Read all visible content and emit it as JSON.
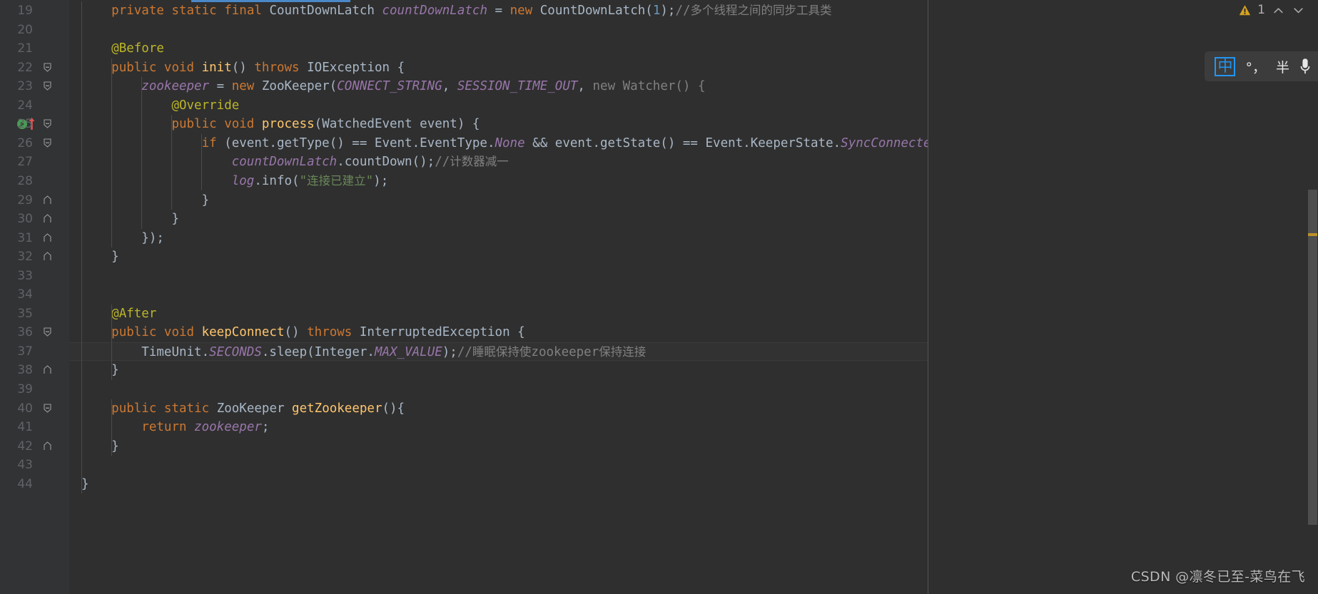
{
  "app": {
    "theme": "darcula",
    "colors": {
      "background": "#2f2f2f",
      "gutter_background": "#313335",
      "current_line_background": "#323232",
      "keyword": "#cc7832",
      "method": "#ffc66d",
      "field": "#9876aa",
      "string": "#6a8759",
      "comment": "#808080",
      "number": "#6897bb",
      "annotation": "#bbb529",
      "default_text": "#a9b7c6",
      "line_number": "#606366",
      "tab_accent": "#4a88c7",
      "warning": "#d6a220",
      "run_marker": "#499c54",
      "override_marker": "#e05252",
      "ime_accent": "#2196f3"
    }
  },
  "inspection_widget": {
    "warning_icon": "warning-triangle-icon",
    "warning_count": "1",
    "prev_icon": "chevron-up-icon",
    "next_icon": "chevron-down-icon"
  },
  "ime_bar": {
    "mode_label": "中",
    "punctuation_label": "°，",
    "width_label": "半",
    "mic_icon": "microphone-icon"
  },
  "scrollbar": {
    "orientation": "vertical",
    "warning_mark_color": "#bb9128"
  },
  "watermark": {
    "text": "CSDN @凛冬已至-菜鸟在飞"
  },
  "editor": {
    "first_visible_line": 19,
    "last_visible_line": 44,
    "current_line": 37,
    "lines": [
      {
        "n": "19",
        "indent": 1,
        "fold": null,
        "tokens": [
          {
            "t": "private ",
            "c": "kw"
          },
          {
            "t": "static ",
            "c": "kw"
          },
          {
            "t": "final ",
            "c": "kw"
          },
          {
            "t": "CountDownLatch ",
            "c": "plain"
          },
          {
            "t": "countDownLatch",
            "c": "field"
          },
          {
            "t": " = ",
            "c": "punc"
          },
          {
            "t": "new ",
            "c": "kw"
          },
          {
            "t": "CountDownLatch(",
            "c": "plain"
          },
          {
            "t": "1",
            "c": "num"
          },
          {
            "t": ");",
            "c": "punc"
          },
          {
            "t": "//多个线程之间的同步工具类",
            "c": "cmt"
          }
        ]
      },
      {
        "n": "20",
        "indent": 1,
        "fold": null,
        "tokens": []
      },
      {
        "n": "21",
        "indent": 1,
        "fold": null,
        "tokens": [
          {
            "t": "@Before",
            "c": "anno"
          }
        ]
      },
      {
        "n": "22",
        "indent": 1,
        "fold": "minus",
        "tokens": [
          {
            "t": "public ",
            "c": "kw"
          },
          {
            "t": "void ",
            "c": "kw"
          },
          {
            "t": "init",
            "c": "fn"
          },
          {
            "t": "() ",
            "c": "punc"
          },
          {
            "t": "throws ",
            "c": "kw"
          },
          {
            "t": "IOException {",
            "c": "plain"
          }
        ]
      },
      {
        "n": "23",
        "indent": 2,
        "fold": "minus",
        "tokens": [
          {
            "t": "zookeeper",
            "c": "field"
          },
          {
            "t": " = ",
            "c": "punc"
          },
          {
            "t": "new ",
            "c": "kw"
          },
          {
            "t": "ZooKeeper(",
            "c": "plain"
          },
          {
            "t": "CONNECT_STRING",
            "c": "const"
          },
          {
            "t": ", ",
            "c": "punc"
          },
          {
            "t": "SESSION_TIME_OUT",
            "c": "const"
          },
          {
            "t": ", ",
            "c": "punc"
          },
          {
            "t": "new Watcher() {",
            "c": "cmt"
          }
        ]
      },
      {
        "n": "24",
        "indent": 3,
        "fold": null,
        "tokens": [
          {
            "t": "@Override",
            "c": "anno"
          }
        ]
      },
      {
        "n": "25",
        "indent": 3,
        "fold": "minus",
        "run_marker": true,
        "override_marker": true,
        "tokens": [
          {
            "t": "public ",
            "c": "kw"
          },
          {
            "t": "void ",
            "c": "kw"
          },
          {
            "t": "process",
            "c": "fn"
          },
          {
            "t": "(WatchedEvent event) {",
            "c": "plain"
          }
        ]
      },
      {
        "n": "26",
        "indent": 4,
        "fold": "minus",
        "tokens": [
          {
            "t": "if ",
            "c": "kw"
          },
          {
            "t": "(event.getType() == Event.EventType.",
            "c": "plain"
          },
          {
            "t": "None",
            "c": "const"
          },
          {
            "t": " && event.getState() == Event.KeeperState.",
            "c": "plain"
          },
          {
            "t": "SyncConnected",
            "c": "const"
          },
          {
            "t": ") {",
            "c": "punc"
          }
        ]
      },
      {
        "n": "27",
        "indent": 5,
        "fold": null,
        "tokens": [
          {
            "t": "countDownLatch",
            "c": "field"
          },
          {
            "t": ".countDown();",
            "c": "plain"
          },
          {
            "t": "//计数器减一",
            "c": "cmt"
          }
        ]
      },
      {
        "n": "28",
        "indent": 5,
        "fold": null,
        "tokens": [
          {
            "t": "log",
            "c": "field"
          },
          {
            "t": ".",
            "c": "punc"
          },
          {
            "t": "info",
            "c": "plain"
          },
          {
            "t": "(",
            "c": "punc"
          },
          {
            "t": "\"连接已建立\"",
            "c": "str"
          },
          {
            "t": ");",
            "c": "punc"
          }
        ]
      },
      {
        "n": "29",
        "indent": 4,
        "fold": "up",
        "tokens": [
          {
            "t": "}",
            "c": "punc"
          }
        ]
      },
      {
        "n": "30",
        "indent": 3,
        "fold": "up",
        "tokens": [
          {
            "t": "}",
            "c": "punc"
          }
        ]
      },
      {
        "n": "31",
        "indent": 2,
        "fold": "up",
        "tokens": [
          {
            "t": "});",
            "c": "punc"
          }
        ]
      },
      {
        "n": "32",
        "indent": 1,
        "fold": "up",
        "tokens": [
          {
            "t": "}",
            "c": "punc"
          }
        ]
      },
      {
        "n": "33",
        "indent": 1,
        "fold": null,
        "tokens": []
      },
      {
        "n": "34",
        "indent": 1,
        "fold": null,
        "tokens": []
      },
      {
        "n": "35",
        "indent": 1,
        "fold": null,
        "tokens": [
          {
            "t": "@After",
            "c": "anno"
          }
        ]
      },
      {
        "n": "36",
        "indent": 1,
        "fold": "minus",
        "tokens": [
          {
            "t": "public ",
            "c": "kw"
          },
          {
            "t": "void ",
            "c": "kw"
          },
          {
            "t": "keepConnect",
            "c": "fn"
          },
          {
            "t": "() ",
            "c": "punc"
          },
          {
            "t": "throws ",
            "c": "kw"
          },
          {
            "t": "InterruptedException {",
            "c": "plain"
          }
        ]
      },
      {
        "n": "37",
        "indent": 2,
        "fold": null,
        "current": true,
        "tokens": [
          {
            "t": "TimeUnit.",
            "c": "plain"
          },
          {
            "t": "SECONDS",
            "c": "const"
          },
          {
            "t": ".sleep(Integer.",
            "c": "plain"
          },
          {
            "t": "MAX_VALUE",
            "c": "const"
          },
          {
            "t": ");",
            "c": "punc"
          },
          {
            "t": "//睡眠保持使zookeeper保持连接",
            "c": "cmt"
          }
        ]
      },
      {
        "n": "38",
        "indent": 1,
        "fold": "up",
        "tokens": [
          {
            "t": "}",
            "c": "punc"
          }
        ]
      },
      {
        "n": "39",
        "indent": 1,
        "fold": null,
        "tokens": []
      },
      {
        "n": "40",
        "indent": 1,
        "fold": "minus",
        "tokens": [
          {
            "t": "public ",
            "c": "kw"
          },
          {
            "t": "static ",
            "c": "kw"
          },
          {
            "t": "ZooKeeper ",
            "c": "plain"
          },
          {
            "t": "getZookeeper",
            "c": "fn"
          },
          {
            "t": "(){",
            "c": "punc"
          }
        ]
      },
      {
        "n": "41",
        "indent": 2,
        "fold": null,
        "tokens": [
          {
            "t": "return ",
            "c": "kw"
          },
          {
            "t": "zookeeper",
            "c": "field"
          },
          {
            "t": ";",
            "c": "punc"
          }
        ]
      },
      {
        "n": "42",
        "indent": 1,
        "fold": "up",
        "tokens": [
          {
            "t": "}",
            "c": "punc"
          }
        ]
      },
      {
        "n": "43",
        "indent": 0,
        "fold": null,
        "tokens": []
      },
      {
        "n": "44",
        "indent": 0,
        "fold": null,
        "tokens": [
          {
            "t": "}",
            "c": "punc"
          }
        ]
      }
    ]
  }
}
